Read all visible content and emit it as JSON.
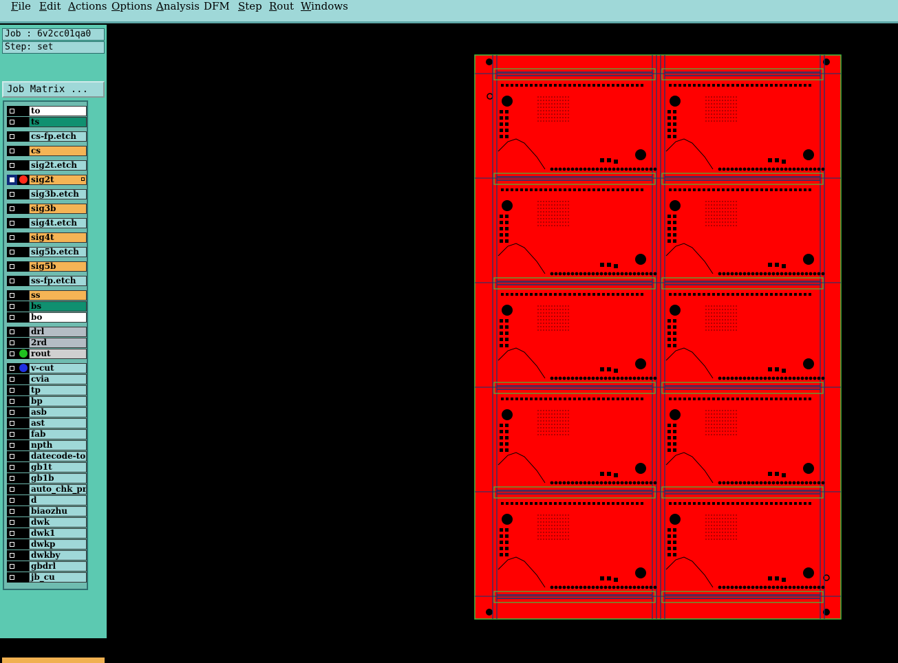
{
  "menu": [
    {
      "label": "File",
      "mnemonic": "F",
      "rest": "ile"
    },
    {
      "label": "Edit",
      "mnemonic": "E",
      "rest": "dit"
    },
    {
      "label": "Actions",
      "mnemonic": "A",
      "rest": "ctions"
    },
    {
      "label": "Options",
      "mnemonic": "O",
      "rest": "ptions"
    },
    {
      "label": "Analysis",
      "mnemonic": "A",
      "rest": "nalysis"
    },
    {
      "label": "DFM",
      "mnemonic": "",
      "rest": "DFM"
    },
    {
      "label": "Step",
      "mnemonic": "S",
      "rest": "tep"
    },
    {
      "label": "Rout",
      "mnemonic": "R",
      "rest": "out"
    },
    {
      "label": "Windows",
      "mnemonic": "W",
      "rest": "indows"
    }
  ],
  "job_label": "Job : 6v2cc01qa0",
  "step_label": "Step: set",
  "job_matrix_button": "Job Matrix ...",
  "layers": [
    {
      "name": "to",
      "bg": "#ffffff"
    },
    {
      "name": "ts",
      "bg": "#109070"
    },
    {
      "name": "cs-fp.etch",
      "bg": "#9fd8d8"
    },
    {
      "name": "cs",
      "bg": "#f5b455"
    },
    {
      "name": "sig2t.etch",
      "bg": "#9fd8d8"
    },
    {
      "name": "sig2t",
      "bg": "#f5b455",
      "active": true,
      "dot": "#ff2a1a",
      "mark": true
    },
    {
      "name": "sig3b.etch",
      "bg": "#9fd8d8"
    },
    {
      "name": "sig3b",
      "bg": "#f5b455"
    },
    {
      "name": "sig4t.etch",
      "bg": "#9fd8d8"
    },
    {
      "name": "sig4t",
      "bg": "#f5b455"
    },
    {
      "name": "sig5b.etch",
      "bg": "#9fd8d8"
    },
    {
      "name": "sig5b",
      "bg": "#f5b455"
    },
    {
      "name": "ss-fp.etch",
      "bg": "#9fd8d8"
    },
    {
      "name": "ss",
      "bg": "#f5b455"
    },
    {
      "name": "bs",
      "bg": "#109070"
    },
    {
      "name": "bo",
      "bg": "#ffffff"
    },
    {
      "name": "drl",
      "bg": "#b4bcc4"
    },
    {
      "name": "2rd",
      "bg": "#b4bcc4"
    },
    {
      "name": "rout",
      "bg": "#d0d0d0",
      "dot": "#20c020"
    },
    {
      "name": "v-cut",
      "bg": "#9fd8d8",
      "dot": "#2030e0"
    },
    {
      "name": "cvia",
      "bg": "#9fd8d8"
    },
    {
      "name": "tp",
      "bg": "#9fd8d8"
    },
    {
      "name": "bp",
      "bg": "#9fd8d8"
    },
    {
      "name": "asb",
      "bg": "#9fd8d8"
    },
    {
      "name": "ast",
      "bg": "#9fd8d8"
    },
    {
      "name": "fab",
      "bg": "#9fd8d8"
    },
    {
      "name": "npth",
      "bg": "#9fd8d8"
    },
    {
      "name": "datecode-to",
      "bg": "#9fd8d8"
    },
    {
      "name": "gb1t",
      "bg": "#9fd8d8"
    },
    {
      "name": "gb1b",
      "bg": "#9fd8d8"
    },
    {
      "name": "auto_chk_pn",
      "bg": "#9fd8d8"
    },
    {
      "name": "d",
      "bg": "#9fd8d8"
    },
    {
      "name": "biaozhu",
      "bg": "#9fd8d8"
    },
    {
      "name": "dwk",
      "bg": "#9fd8d8"
    },
    {
      "name": "dwk1",
      "bg": "#9fd8d8"
    },
    {
      "name": "dwkp",
      "bg": "#9fd8d8"
    },
    {
      "name": "dwkby",
      "bg": "#9fd8d8"
    },
    {
      "name": "gbdrl",
      "bg": "#9fd8d8"
    },
    {
      "name": "jb_cu",
      "bg": "#9fd8d8"
    }
  ],
  "panel": {
    "rows": 5,
    "cols": 2,
    "copper_color": "#ff0000",
    "outline_color": "#40c040",
    "frame_color": "#0a3a7a"
  }
}
